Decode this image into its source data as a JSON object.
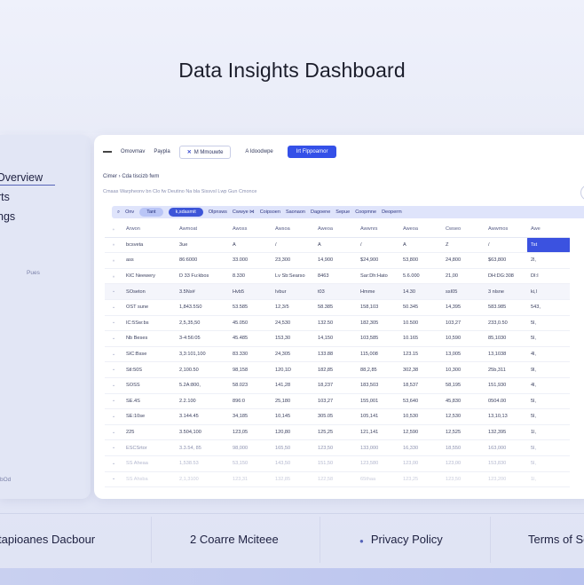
{
  "title": "Data Insights Dashboard",
  "sidebar": {
    "items": [
      "Overview",
      "rts",
      "ngs"
    ],
    "small_1": "Pues",
    "small_2": "bOd"
  },
  "nav": {
    "item1": "Omovmav",
    "item2": "Paypla",
    "chip": "M Mmouwte",
    "chip2": "A Idoodwpe",
    "blue": "Irt Flppoamor"
  },
  "breadcrumb": "Cimer  ›  Cda tiscizb fwm",
  "subline": "Cmaas  Warpheonv bn Clo fw Deutino  Na bla Sissvsl Lwp Gun Cmonce",
  "toolbar": [
    "Onv",
    "Tant",
    "k,sdasmit",
    "Olpnsws",
    "Cwwye ⋈",
    "Coipsoen",
    "Saonaon",
    "Dagoene",
    "Sepue",
    "Coopmne",
    "Deoperm"
  ],
  "table": {
    "headers": [
      "Arwon",
      "Awmoat",
      "Awoss",
      "Awsoa",
      "Aweoa",
      "Awwnrs",
      "Aweoa",
      "Cwseo",
      "Awwmos",
      "Awe"
    ],
    "rows": [
      [
        "bcsveta",
        "3ue",
        "A",
        "/",
        "A",
        "/",
        "A",
        "Z",
        "/",
        "Tst"
      ],
      [
        "ass",
        "86:6000",
        "33.000",
        "23,300",
        "14,900",
        "$24,900",
        "53,800",
        "24,800",
        "$63,800",
        "2l,"
      ],
      [
        "KIC Neewery",
        "D 33 Fu:kbos",
        "8.330",
        "Lv Sb:Searso",
        "8463",
        "Sar:Dh:Hato",
        "5.6.000",
        "21,00",
        "DH:DG:308",
        "DI:I"
      ],
      [
        "SOseton",
        "3.5Ns#",
        "Hvb5",
        "Ivbur",
        "t03",
        "Hmme",
        "14.30",
        "ssI05",
        "3 nlsne",
        "ki,l"
      ],
      [
        "OST sune",
        "1,843.5S0",
        "53.585",
        "12,3/5",
        "58.385",
        "158,103",
        "50.345",
        "14,395",
        "583.985",
        "543,"
      ],
      [
        "IC:5Sw:bs",
        "2,5,35,50",
        "45.050",
        "24,530",
        "132.50",
        "182,305",
        "10.500",
        "103,27",
        "233,0.50",
        "5l,"
      ],
      [
        "Nb Beses",
        "3-4:56:05",
        "45.485",
        "153,30",
        "14,150",
        "103,585",
        "10.165",
        "10,590",
        "85,1030",
        "5l,"
      ],
      [
        "SIC:Bsse",
        "3,3:101,100",
        "83.330",
        "24,305",
        "133.88",
        "115,008",
        "123.15",
        "13,005",
        "13,1038",
        "4l,"
      ],
      [
        "Stl:50S",
        "2,100.50",
        "98,158",
        "120,1D",
        "182,85",
        "88,2,85",
        "302,38",
        "10,300",
        "25b,311",
        "9l,"
      ],
      [
        "SOSS",
        "5.2A:800,",
        "58.023",
        "141,28",
        "18,237",
        "183,503",
        "18,537",
        "58,195",
        "151,930",
        "4l,"
      ],
      [
        "SE.4S",
        "2.2.100",
        "896:0",
        "25,180",
        "103,27",
        "155,001",
        "53,640",
        "45,830",
        "0504.00",
        "5l,"
      ],
      [
        "SE:10se",
        "3.144.45",
        "34,185",
        "10,145",
        "305.05",
        "105,141",
        "10,530",
        "12,530",
        "13,10,13",
        "5l,"
      ],
      [
        "225",
        "3.504,100",
        "123,05",
        "120,80",
        "125,25",
        "121,141",
        "12,590",
        "12,525",
        "132,395",
        "1l,"
      ],
      [
        "ESCSrtor",
        "3.3.54, 85",
        "98,000",
        "165,50",
        "123,50",
        "133,000",
        "16,330",
        "18,550",
        "163,000",
        "5l,"
      ],
      [
        "SS Aheaa",
        "1,538.53",
        "53,150",
        "143,50",
        "151,50",
        "123,580",
        "123,00",
        "123,00",
        "153,830",
        "5l,"
      ],
      [
        "SS Ahsba",
        "2,1,3100",
        "123,31",
        "132,85",
        "122,58",
        "65thaa",
        "123,25",
        "123,50",
        "123,200",
        "1l,"
      ]
    ]
  },
  "footer": [
    "tapioanes Dacbour",
    "2  Coarre Mciteee",
    "Privacy Policy",
    "Terms of Se"
  ],
  "colors": {
    "accent": "#3450e8",
    "sidebar": "#e2e6f5",
    "background": "#eef0fa"
  }
}
